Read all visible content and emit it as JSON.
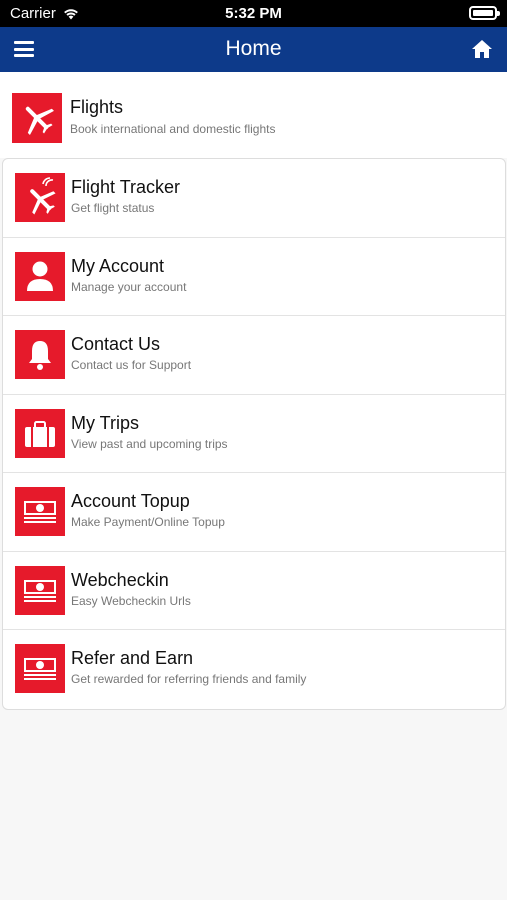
{
  "status_bar": {
    "carrier": "Carrier",
    "time": "5:32 PM"
  },
  "header": {
    "title": "Home"
  },
  "flights": {
    "label": "Flights",
    "subtitle": "Book international and domestic flights",
    "icon": "airplane-icon"
  },
  "menu_items": [
    {
      "label": "Flight Tracker",
      "subtitle": "Get flight status",
      "icon": "flight-tracker-icon"
    },
    {
      "label": "My Account",
      "subtitle": "Manage your account",
      "icon": "user-icon"
    },
    {
      "label": "Contact Us",
      "subtitle": "Contact us for Support",
      "icon": "bell-icon"
    },
    {
      "label": "My Trips",
      "subtitle": "View past and upcoming trips",
      "icon": "briefcase-icon"
    },
    {
      "label": "Account Topup",
      "subtitle": "Make Payment/Online Topup",
      "icon": "money-icon"
    },
    {
      "label": "Webcheckin",
      "subtitle": "Easy Webcheckin Urls",
      "icon": "money-icon"
    },
    {
      "label": "Refer and Earn",
      "subtitle": "Get rewarded for referring friends and family",
      "icon": "money-icon"
    }
  ],
  "colors": {
    "nav": "#0d3a8a",
    "accent": "#e61a2b"
  }
}
